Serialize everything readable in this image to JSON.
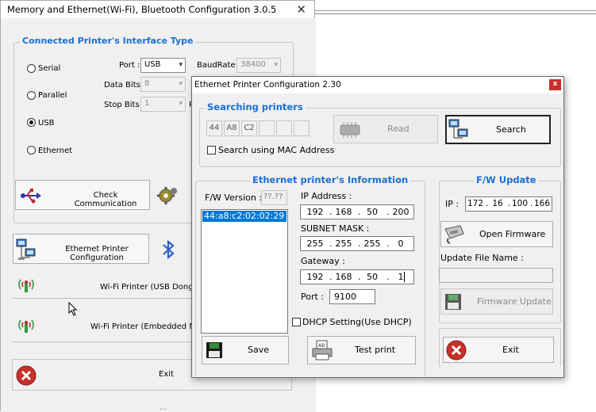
{
  "main_window": {
    "title": "Memory and Ethernet(Wi-Fi), Bluetooth Configuration 3.0.5",
    "close_glyph": "✕",
    "interface_group": {
      "label": "Connected Printer's Interface Type",
      "radios": [
        {
          "label": "Serial",
          "selected": false
        },
        {
          "label": "Parallel",
          "selected": false
        },
        {
          "label": "USB",
          "selected": true
        },
        {
          "label": "Ethernet",
          "selected": false
        }
      ],
      "port_label": "Port :",
      "port_value": "USB",
      "baud_label": "BaudRate :",
      "baud_value": "38400",
      "databits_label": "Data Bits :",
      "databits_value": "8",
      "stopbits_label": "Stop Bits :",
      "stopbits_value": "1",
      "parity_partial": "P",
      "check_comm_label": "Check Communication"
    },
    "ethernet_config_label": "Ethernet Printer Configuration",
    "wifi_usb_label": "Wi-Fi Printer (USB Dongle) Co",
    "wifi_embedded_label": "Wi-Fi Printer (Embedded Module",
    "exit_label": "Exit",
    "bottom_partial": "..."
  },
  "dialog": {
    "title": "Ethernet Printer Configuration 2.30",
    "close_glyph": "x",
    "searching": {
      "label": "Searching printers",
      "progress_boxes": [
        "44",
        "A8",
        "C2",
        "",
        "",
        ""
      ],
      "read_label": "Read",
      "search_label": "Search",
      "mac_checkbox_label": "Search using MAC Address",
      "mac_checked": false
    },
    "info": {
      "label": "Ethernet printer's Information",
      "fw_version_label": "F/W Version :",
      "fw_version_value": "??.??",
      "found_list": [
        "44:a8:c2:02:02:29"
      ],
      "ip_label": "IP Address :",
      "ip": [
        "192",
        "168",
        "50",
        "200"
      ],
      "subnet_label": "SUBNET MASK :",
      "subnet": [
        "255",
        "255",
        "255",
        "0"
      ],
      "gateway_label": "Gateway :",
      "gateway": [
        "192",
        "168",
        "50",
        "1"
      ],
      "port_label": "Port :",
      "port_value": "9100",
      "dhcp_label": "DHCP Setting(Use DHCP)",
      "dhcp_checked": false,
      "save_label": "Save",
      "test_print_label": "Test print"
    },
    "fw_update": {
      "label": "F/W Update",
      "ip_label": "IP :",
      "ip": [
        "172",
        "16",
        "100",
        "166"
      ],
      "open_firmware_label": "Open Firmware",
      "update_file_label": "Update File Name :",
      "update_file_value": "",
      "firmware_update_label": "Firmware Update"
    },
    "exit_label": "Exit"
  },
  "colors": {
    "group_label": "#1a6fd3",
    "selection": "#0078d7",
    "close_red": "#c8302a"
  }
}
